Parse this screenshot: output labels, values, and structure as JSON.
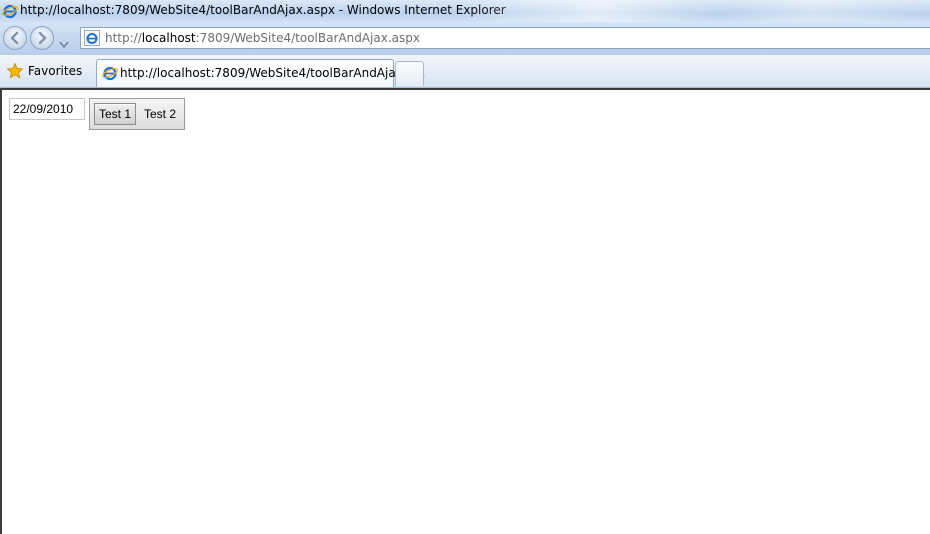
{
  "window": {
    "title": "http://localhost:7809/WebSite4/toolBarAndAjax.aspx - Windows Internet Explorer"
  },
  "address_bar": {
    "url_prefix": "http://",
    "url_host": "localhost",
    "url_rest": ":7809/WebSite4/toolBarAndAjax.aspx"
  },
  "favorites": {
    "label": "Favorites"
  },
  "tabs": [
    {
      "label": "http://localhost:7809/WebSite4/toolBarAndAjax.a..."
    }
  ],
  "page": {
    "date_value": "22/09/2010",
    "toolbar": {
      "buttons": [
        {
          "label": "Test 1"
        },
        {
          "label": "Test 2"
        }
      ]
    }
  },
  "colors": {
    "titlebar": "#c6daf1",
    "ie_blue": "#1e6fd0",
    "star": "#f5b800"
  },
  "icons": {
    "browser": "ie-icon",
    "back": "back-arrow-icon",
    "forward": "forward-arrow-icon",
    "favorites": "star-icon"
  }
}
